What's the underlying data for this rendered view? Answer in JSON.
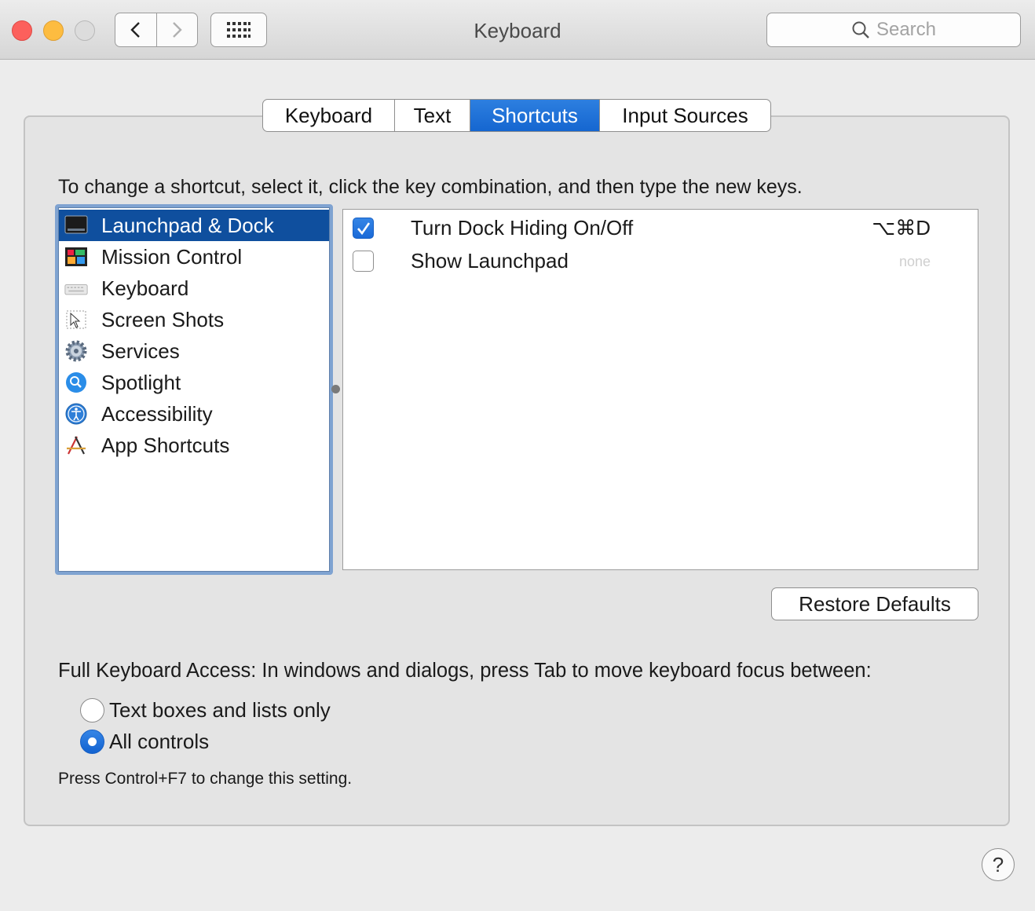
{
  "window": {
    "title": "Keyboard"
  },
  "search": {
    "placeholder": "Search"
  },
  "tabs": [
    {
      "label": "Keyboard"
    },
    {
      "label": "Text"
    },
    {
      "label": "Shortcuts",
      "active": true
    },
    {
      "label": "Input Sources"
    }
  ],
  "instruction": "To change a shortcut, select it, click the key combination, and then type the new keys.",
  "categories": [
    {
      "label": "Launchpad & Dock",
      "icon": "launchpad-dock-icon",
      "selected": true
    },
    {
      "label": "Mission Control",
      "icon": "mission-control-icon"
    },
    {
      "label": "Keyboard",
      "icon": "keyboard-icon"
    },
    {
      "label": "Screen Shots",
      "icon": "screenshots-icon"
    },
    {
      "label": "Services",
      "icon": "services-gear-icon"
    },
    {
      "label": "Spotlight",
      "icon": "spotlight-icon"
    },
    {
      "label": "Accessibility",
      "icon": "accessibility-icon"
    },
    {
      "label": "App Shortcuts",
      "icon": "app-shortcuts-icon"
    }
  ],
  "shortcuts": [
    {
      "label": "Turn Dock Hiding On/Off",
      "checked": true,
      "key": "⌥⌘D"
    },
    {
      "label": "Show Launchpad",
      "checked": false,
      "key": "none"
    }
  ],
  "restore_defaults": "Restore Defaults",
  "full_keyboard_access": {
    "label": "Full Keyboard Access: In windows and dialogs, press Tab to move keyboard focus between:",
    "options": [
      {
        "label": "Text boxes and lists only",
        "selected": false
      },
      {
        "label": "All controls",
        "selected": true
      }
    ],
    "hint": "Press Control+F7 to change this setting."
  },
  "help": "?",
  "colors": {
    "accent": "#1a6ad8",
    "selection": "#0f4f9e"
  }
}
